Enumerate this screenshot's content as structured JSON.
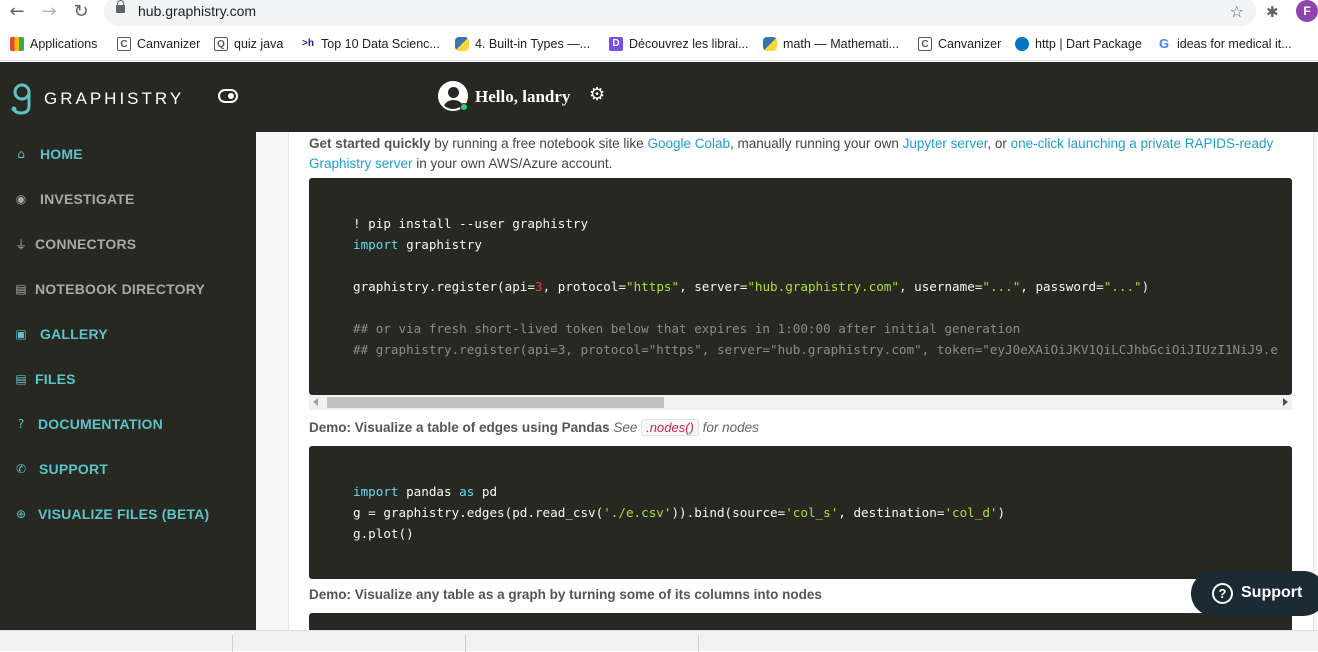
{
  "browser": {
    "url": "hub.graphistry.com",
    "profile_initial": "F",
    "bookmarks": [
      {
        "label": "Applications",
        "icon": "apps-grid-icon"
      },
      {
        "label": "Canvanizer",
        "icon": "canvanizer-icon"
      },
      {
        "label": "quiz java",
        "icon": "quiz-icon"
      },
      {
        "label": "Top 10 Data Scienc...",
        "icon": "prompt-icon"
      },
      {
        "label": "4. Built-in Types —...",
        "icon": "python-icon"
      },
      {
        "label": "Découvrez les librai...",
        "icon": "openclassrooms-icon"
      },
      {
        "label": "math — Mathemati...",
        "icon": "python-icon"
      },
      {
        "label": "Canvanizer",
        "icon": "canvanizer-icon"
      },
      {
        "label": "http | Dart Package",
        "icon": "dart-icon"
      },
      {
        "label": "ideas for medical it...",
        "icon": "google-icon"
      }
    ]
  },
  "header": {
    "logo_text": "GRAPHISTRY",
    "greeting": "Hello, landry"
  },
  "sidebar": {
    "items": [
      {
        "label": "HOME",
        "icon": "home-icon"
      },
      {
        "label": "INVESTIGATE",
        "icon": "eye-icon"
      },
      {
        "label": "CONNECTORS",
        "icon": "plug-icon"
      },
      {
        "label": "NOTEBOOK DIRECTORY",
        "icon": "file-icon"
      },
      {
        "label": "GALLERY",
        "icon": "images-icon"
      },
      {
        "label": "FILES",
        "icon": "file-icon"
      },
      {
        "label": "DOCUMENTATION",
        "icon": "question-icon"
      },
      {
        "label": "SUPPORT",
        "icon": "phone-icon"
      },
      {
        "label": "VISUALIZE FILES (BETA)",
        "icon": "plus-circle-icon"
      }
    ]
  },
  "main": {
    "intro": {
      "bold": "Get started quickly",
      "t1": " by running a free notebook site like ",
      "link1": "Google Colab",
      "t2": ", manually running your own ",
      "link2": "Jupyter server",
      "t3": ", or ",
      "link3": "one-click launching a private RAPIDS-ready Graphistry server",
      "t4": " in your own AWS/Azure account."
    },
    "code1": {
      "l1": "! pip install --user graphistry",
      "l2_kw": "import",
      "l2": " graphistry",
      "l3a": "graphistry.register(api=",
      "l3_num": "3",
      "l3b": ", protocol=",
      "l3_s1": "\"https\"",
      "l3c": ", server=",
      "l3_s2": "\"hub.graphistry.com\"",
      "l3d": ", username=",
      "l3_s3": "\"...\"",
      "l3e": ", password=",
      "l3_s4": "\"...\"",
      "l3f": ")",
      "c1": "## or via fresh short-lived token below that expires in 1:00:00 after initial generation",
      "c2": "## graphistry.register(api=3, protocol=\"https\", server=\"hub.graphistry.com\", token=\"eyJ0eXAiOiJKV1QiLCJhbGciOiJIUzI1NiJ9.e"
    },
    "demo1": {
      "bold": "Demo: Visualize a table of edges using Pandas",
      "see": "See",
      "code": ".nodes()",
      "tail": "for nodes"
    },
    "code2": {
      "l1_kw1": "import",
      "l1a": " pandas ",
      "l1_kw2": "as",
      "l1b": " pd",
      "l2a": "g = graphistry.edges(pd.read_csv(",
      "l2_s1": "'./e.csv'",
      "l2b": ")).bind(source=",
      "l2_s2": "'col_s'",
      "l2c": ", destination=",
      "l2_s3": "'col_d'",
      "l2d": ")",
      "l3": "g.plot()"
    },
    "demo2": {
      "bold": "Demo: Visualize any table as a graph by turning some of its columns into nodes"
    }
  },
  "support_button": {
    "label": "Support"
  }
}
